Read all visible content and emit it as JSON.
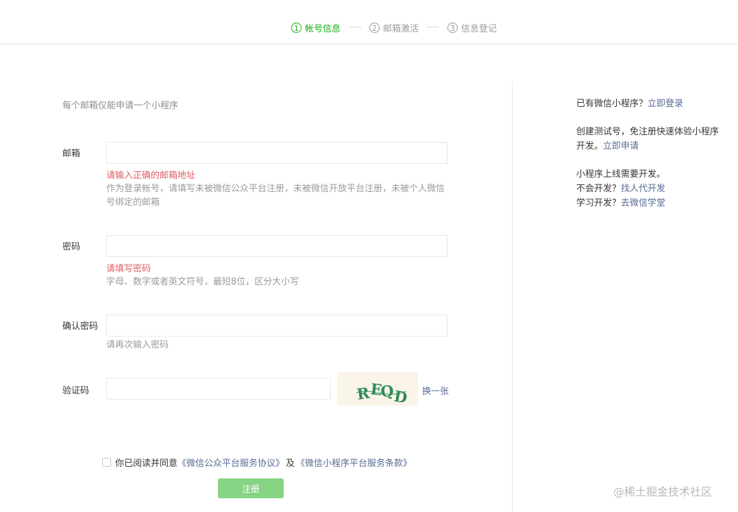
{
  "steps": [
    {
      "num": "1",
      "label": "帐号信息"
    },
    {
      "num": "2",
      "label": "邮箱激活"
    },
    {
      "num": "3",
      "label": "信息登记"
    }
  ],
  "form": {
    "notice": "每个邮箱仅能申请一个小程序",
    "email": {
      "label": "邮箱",
      "value": "",
      "error": "请输入正确的邮箱地址",
      "tip": "作为登录帐号，请填写未被微信公众平台注册，未被微信开放平台注册，未被个人微信号绑定的邮箱"
    },
    "password": {
      "label": "密码",
      "value": "",
      "error": "请填写密码",
      "tip": "字母、数字或者英文符号，最短8位，区分大小写"
    },
    "confirm": {
      "label": "确认密码",
      "value": "",
      "tip": "请再次输入密码"
    },
    "captcha": {
      "label": "验证码",
      "value": "",
      "image_text": "REQD",
      "refresh": "换一张"
    },
    "agree": {
      "text": "你已阅读并同意",
      "link1": "《微信公众平台服务协议》",
      "and": "及",
      "link2": "《微信小程序平台服务条款》"
    },
    "submit": "注册"
  },
  "side": {
    "login_prompt": "已有微信小程序？",
    "login_link": "立即登录",
    "test_text": "创建测试号，免注册快速体验小程序开发。",
    "test_link": "立即申请",
    "dev_line": "小程序上线需要开发。",
    "dev_q1": "不会开发？",
    "dev_link1": "找人代开发",
    "dev_q2": "学习开发？",
    "dev_link2": "去微信学堂"
  },
  "watermark": "@稀土掘金技术社区",
  "colors": {
    "active": "#1aad19",
    "link": "#576b95",
    "error": "#e15f63",
    "button": "#86d384"
  }
}
